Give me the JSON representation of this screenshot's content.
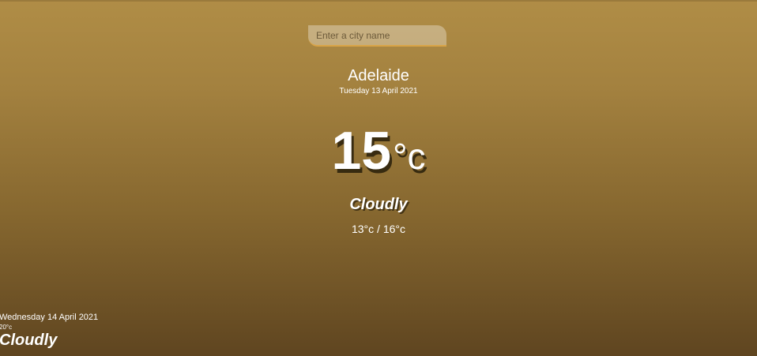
{
  "search": {
    "placeholder": "Enter a city name",
    "value": ""
  },
  "current": {
    "city": "Adelaide",
    "date": "Tuesday 13 April 2021",
    "temperature": "15",
    "unit": "°c",
    "condition": "Cloudly",
    "low_high": "13°c / 16°c"
  },
  "forecast": [
    {
      "date": "Wednesday 14 April 2021",
      "temperature": "20°c",
      "condition": "Cloudly"
    }
  ],
  "colors": {
    "background_top": "#b08d46",
    "background_bottom": "#5f4520",
    "input_accent": "#d9a447",
    "text": "#ffffff"
  }
}
